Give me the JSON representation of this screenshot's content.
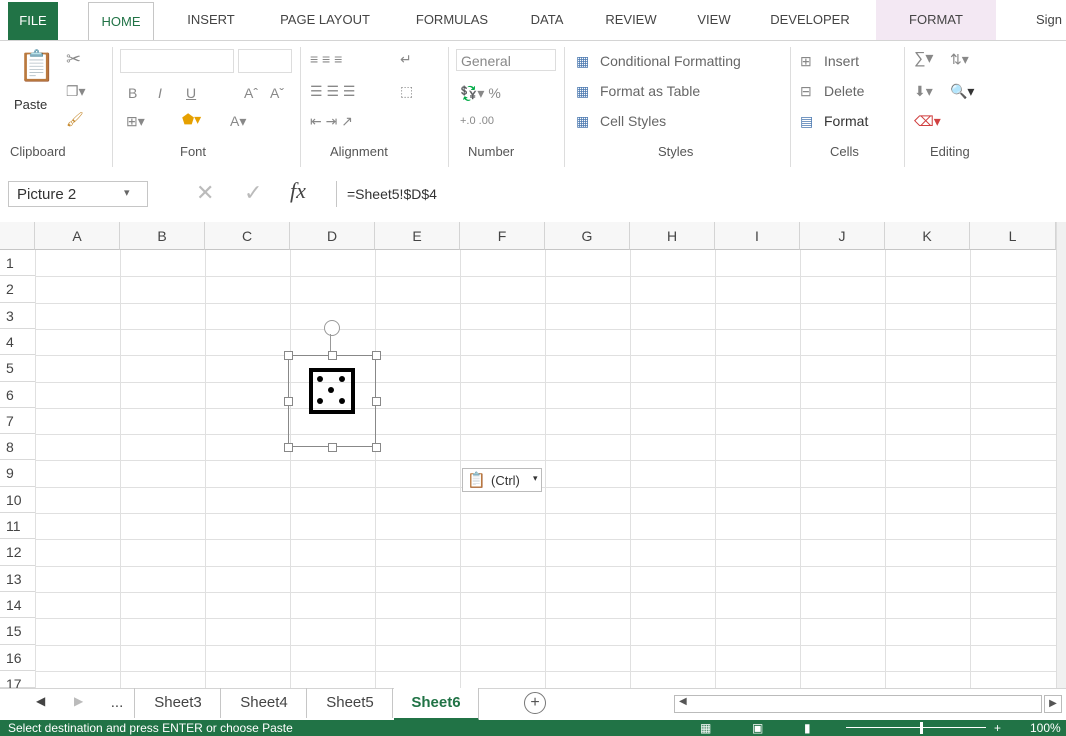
{
  "tabs": [
    "FILE",
    "HOME",
    "INSERT",
    "PAGE LAYOUT",
    "FORMULAS",
    "DATA",
    "REVIEW",
    "VIEW",
    "DEVELOPER",
    "FORMAT",
    "Sign"
  ],
  "ribbon": {
    "paste_label": "Paste",
    "groups": {
      "clipboard": "Clipboard",
      "font": "Font",
      "alignment": "Alignment",
      "number": "Number",
      "styles": "Styles",
      "cells": "Cells",
      "editing": "Editing"
    },
    "number_format": "General",
    "styles_items": [
      "Conditional Formatting",
      "Format as Table",
      "Cell Styles"
    ],
    "cells_items": [
      "Insert",
      "Delete",
      "Format"
    ]
  },
  "formula_bar": {
    "name_box": "Picture 2",
    "fx": "fx",
    "formula": "=Sheet5!$D$4"
  },
  "columns": [
    "A",
    "B",
    "C",
    "D",
    "E",
    "F",
    "G",
    "H",
    "I",
    "J",
    "K",
    "L"
  ],
  "rows": [
    "1",
    "2",
    "3",
    "4",
    "5",
    "6",
    "7",
    "8",
    "9",
    "10",
    "11",
    "12",
    "13",
    "14",
    "15",
    "16",
    "17"
  ],
  "paste_options_label": "(Ctrl)",
  "sheet_tabs": [
    "...",
    "Sheet3",
    "Sheet4",
    "Sheet5",
    "Sheet6"
  ],
  "active_sheet": "Sheet6",
  "status_text": "Select destination and press ENTER or choose Paste",
  "zoom": "100%",
  "colors": {
    "accent": "#217346"
  }
}
